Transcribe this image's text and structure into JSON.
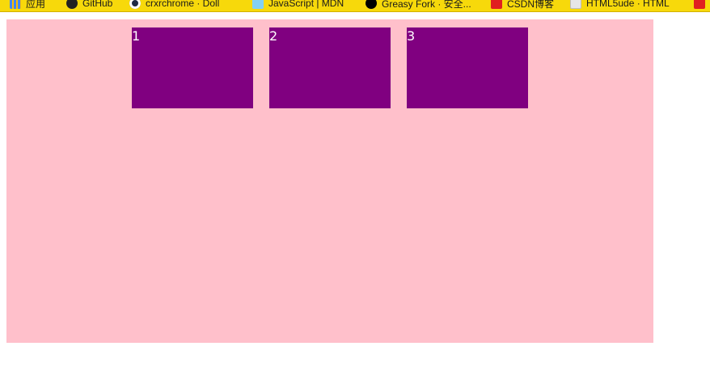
{
  "bookmarks": [
    {
      "label": "应用",
      "icon": "apps-grid-icon"
    },
    {
      "label": "GitHub",
      "icon": "github-icon"
    },
    {
      "label": "crxrchrome · Doll",
      "icon": "crx-icon"
    },
    {
      "label": "JavaScript | MDN",
      "icon": "mdn-icon"
    },
    {
      "label": "Greasy Fork · 安全...",
      "icon": "greasy-fork-icon"
    },
    {
      "label": "CSDN博客",
      "icon": "csdn-icon"
    },
    {
      "label": "HTML5ude · HTML",
      "icon": "html5-icon"
    },
    {
      "label": "",
      "icon": "bookmark-icon"
    }
  ],
  "colors": {
    "bookmarks_bar": "#f7d90b",
    "container": "#ffc0cb",
    "box": "#800080",
    "box_text": "#ffffff"
  },
  "boxes": [
    {
      "label": "1"
    },
    {
      "label": "2"
    },
    {
      "label": "3"
    }
  ]
}
